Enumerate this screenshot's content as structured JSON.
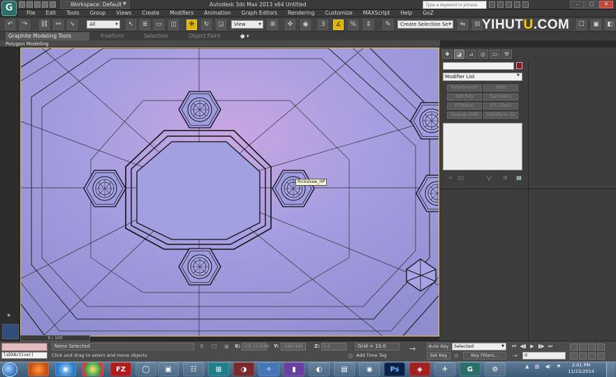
{
  "titlebar": {
    "logo_text": "G",
    "workspace": "Workspace: Default",
    "title": "Autodesk 3ds Max 2013 x64      Untitled",
    "search_placeholder": "Type a keyword or phrase"
  },
  "menus": [
    "File",
    "Edit",
    "Tools",
    "Group",
    "Views",
    "Create",
    "Modifiers",
    "Animation",
    "Graph Editors",
    "Rendering",
    "Customize",
    "MAXScript",
    "Help",
    "GoZ"
  ],
  "toolbar": {
    "filter": "All",
    "refcoord": "View",
    "selection_set": "Create Selection Se",
    "snap_label": "3",
    "angle_snap": "%"
  },
  "watermark": {
    "a": "YIHUT",
    "dot": "U",
    "b": ".COM"
  },
  "ribbon": {
    "tabs": [
      "Graphite Modeling Tools",
      "Freeform",
      "Selection",
      "Object Paint"
    ],
    "sub": "Polygon Modeling"
  },
  "viewport": {
    "tooltip": "Rickshaw_HP"
  },
  "command_panel": {
    "modifier_list": "Modifier List",
    "buttons": [
      "TurboSmooth",
      "Shell",
      "Edit Poly",
      "Symmetry",
      "FFD(box)",
      "STL Check",
      "Unwrap UVW",
      "HSDeform (E)"
    ]
  },
  "status": {
    "time_slider": "0 / 100",
    "maxscript": "lsDXActive()",
    "selection": "None Selected",
    "prompt": "Click and drag to select and move objects",
    "x_label": "X:",
    "x": "150.153569",
    "y_label": "Y:",
    "y": "-5867492",
    "z_label": "Z:",
    "z": "0.0",
    "grid": "Grid = 10.0",
    "add_time_tag": "Add Time Tag",
    "auto_key": "Auto Key",
    "set_key": "Set Key",
    "selected": "Selected",
    "key_filters": "Key Filters...",
    "frame": "0"
  },
  "taskbar": {
    "time": "2:01 PM",
    "date": "11/15/2014",
    "fz_label": "FZ",
    "ps_label": "Ps"
  }
}
